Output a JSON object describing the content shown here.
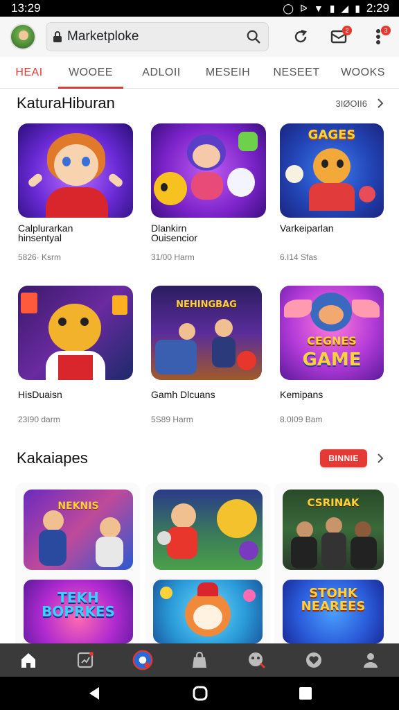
{
  "status_bar": {
    "time": "13:29",
    "time_right": "2:29"
  },
  "search": {
    "value": "Marketploke"
  },
  "header": {
    "notification_badge": "2",
    "more_badge": "3"
  },
  "tabs": [
    {
      "label": "HEAI",
      "active": true
    },
    {
      "label": "WOOEE"
    },
    {
      "label": "ADLOII"
    },
    {
      "label": "MESEIH"
    },
    {
      "label": "NESEET"
    },
    {
      "label": "WOOKS"
    }
  ],
  "section1": {
    "title": "KaturaHiburan",
    "link": "3IØOII6",
    "apps": [
      {
        "name": "Calplurarkan\nhinsentyal",
        "meta": "5826· Ksrm"
      },
      {
        "name": "Dlankirn\nOuisencior",
        "meta": "31/00 Harm"
      },
      {
        "name": "Varkeiparlan",
        "meta": "6.I14 Sfas"
      },
      {
        "name": "HisDuaisn",
        "meta": "23I90 darm"
      },
      {
        "name": "Gamh Dlcuans",
        "meta": "5S89 Harm"
      },
      {
        "name": "Kemipans",
        "meta": "8.0I09 Bam"
      }
    ]
  },
  "section2": {
    "title": "Kakaiapes",
    "button": "BINNIE",
    "tiles": [
      {
        "caption": "NEKNIS"
      },
      {
        "caption": ""
      },
      {
        "caption": "CSRINAK"
      },
      {
        "caption": "TEKH BOPRKES"
      },
      {
        "caption": ""
      },
      {
        "caption": "STOHK NEAREES"
      }
    ]
  },
  "thumb_captions": {
    "games": "GAGES",
    "nehingbag": "NEHINGBAG",
    "cegnes": "CEGNES",
    "game": "GAME"
  },
  "colors": {
    "accent": "#e53935",
    "nav_bg": "#3a3a3a"
  }
}
